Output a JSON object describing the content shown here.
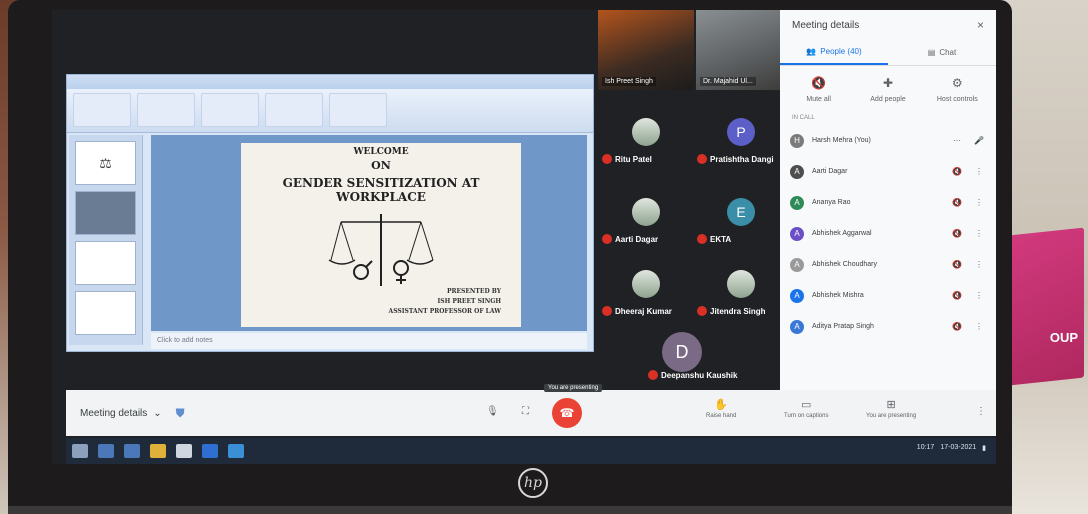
{
  "slide": {
    "welcome": "WELCOME",
    "on": "ON",
    "title": "GENDER SENSITIZATION AT WORKPLACE",
    "presented_by": "PRESENTED BY",
    "presenter": "ISH PREET SINGH",
    "role": "ASSISTANT PROFESSOR OF LAW",
    "notes_placeholder": "Click to add notes"
  },
  "video_tiles": [
    {
      "name": "Ish Preet Singh"
    },
    {
      "name": "Dr. Majahid Ul..."
    }
  ],
  "participant_tiles": [
    {
      "name": "Ritu Patel",
      "initial": "",
      "color": "#8fa38f"
    },
    {
      "name": "Pratishtha Dangi",
      "initial": "P",
      "color": "#5b5fc7"
    },
    {
      "name": "Aarti Dagar",
      "initial": "",
      "color": "#8fa38f"
    },
    {
      "name": "EKTA",
      "initial": "E",
      "color": "#3a8ea8"
    },
    {
      "name": "Dheeraj Kumar",
      "initial": "",
      "color": "#8fa38f"
    },
    {
      "name": "Jitendra Singh",
      "initial": "",
      "color": "#8fa38f"
    }
  ],
  "deepanshu": {
    "initial": "D",
    "name": "Deepanshu Kaushik"
  },
  "panel": {
    "title": "Meeting details",
    "close": "×",
    "tab_people": "People (40)",
    "tab_chat": "Chat",
    "actions": [
      "Mute all",
      "Add people",
      "Host controls"
    ],
    "section": "IN CALL",
    "people": [
      {
        "name": "Harsh Mehra (You)",
        "color": "#7b7b7b",
        "initial": "H"
      },
      {
        "name": "Aarti Dagar",
        "color": "#4e4e4e",
        "initial": "A"
      },
      {
        "name": "Ananya Rao",
        "color": "#2e8b57",
        "initial": "A"
      },
      {
        "name": "Abhishek Aggarwal",
        "color": "#6a4fc7",
        "initial": "A"
      },
      {
        "name": "Abhishek Choudhary",
        "color": "#9a9a9a",
        "initial": "A"
      },
      {
        "name": "Abhishek Mishra",
        "color": "#1a73e8",
        "initial": "A"
      },
      {
        "name": "Aditya Pratap Singh",
        "color": "#3a78d8",
        "initial": "A"
      }
    ]
  },
  "meetbar": {
    "details": "Meeting details",
    "present_tip": "You are presenting",
    "items": [
      "Raise hand",
      "Turn on captions",
      "You are presenting"
    ]
  },
  "tray": {
    "time": "10:17",
    "date": "17-03-2021"
  },
  "colors": {
    "accent": "#1a73e8",
    "leave": "#ea4335"
  }
}
